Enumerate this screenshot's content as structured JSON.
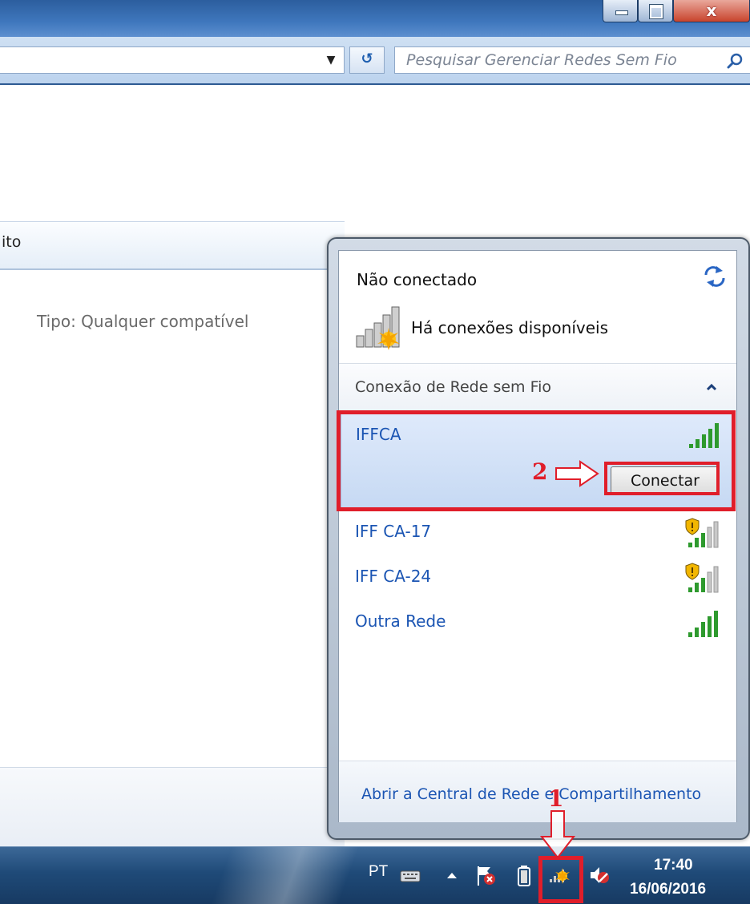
{
  "window": {
    "close_label": "x",
    "search_placeholder": "Pesquisar Gerenciar Redes Sem Fio"
  },
  "background_window": {
    "header_text": "ito",
    "type_text": "Tipo:  Qualquer compatível"
  },
  "flyout": {
    "status_title": "Não conectado",
    "available_text": "Há conexões disponíveis",
    "section_label": "Conexão de Rede sem Fio",
    "networks": [
      {
        "name": "IFFCA",
        "secured": false,
        "signal_bars": 5,
        "selected": true
      },
      {
        "name": "IFF CA-17",
        "secured": true,
        "signal_bars": 3
      },
      {
        "name": "IFF CA-24",
        "secured": true,
        "signal_bars": 3
      },
      {
        "name": "Outra Rede",
        "secured": false,
        "signal_bars": 5
      }
    ],
    "connect_button": "Conectar",
    "footer_link": "Abrir a Central de Rede e Compartilhamento"
  },
  "annotations": {
    "step1": "1",
    "step2": "2",
    "color": "#e01e2a"
  },
  "taskbar": {
    "language": "PT",
    "time": "17:40",
    "date": "16/06/2016"
  },
  "colors": {
    "link_blue": "#1b55b3",
    "signal_green": "#2e9a2e",
    "selection": "#c6d9f3"
  }
}
